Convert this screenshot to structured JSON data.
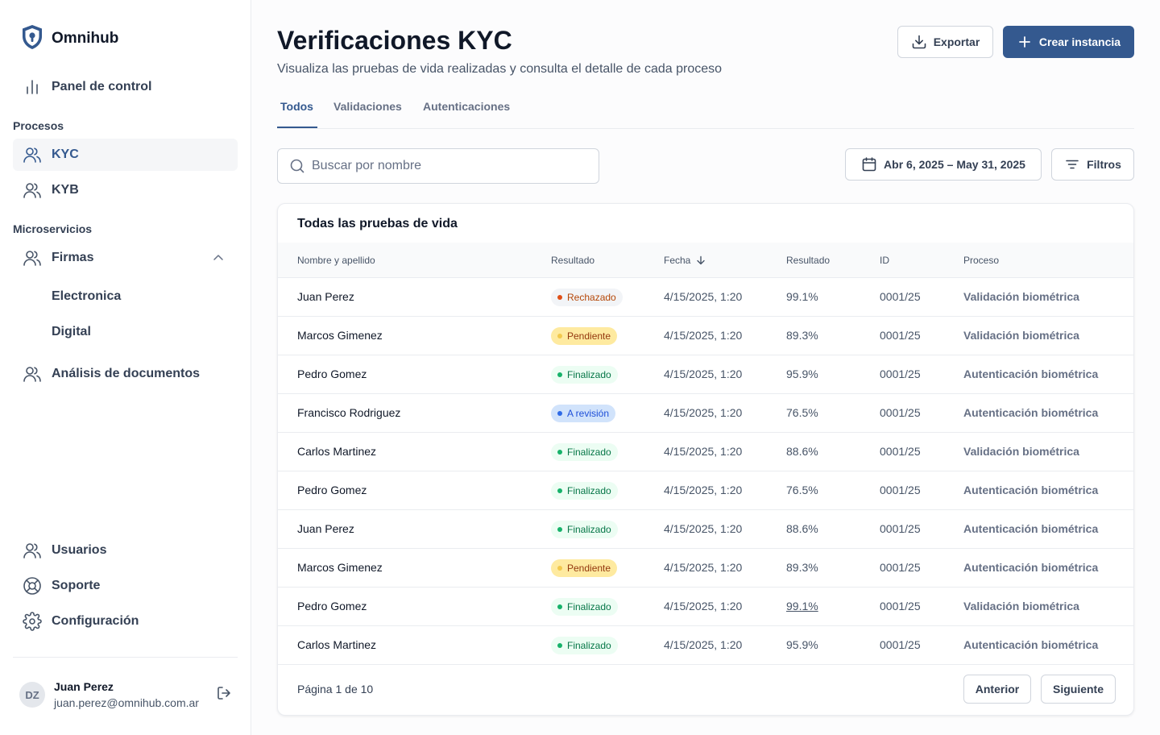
{
  "app": {
    "name": "Omnihub"
  },
  "sidebar": {
    "dashboard": "Panel de control",
    "section_procesos": "Procesos",
    "kyc": "KYC",
    "kyb": "KYB",
    "section_microservicios": "Microservicios",
    "firmas": "Firmas",
    "firmas_children": [
      "Electronica",
      "Digital"
    ],
    "analisis": "Análisis de documentos",
    "usuarios": "Usuarios",
    "soporte": "Soporte",
    "configuracion": "Configuración"
  },
  "user": {
    "initials": "DZ",
    "name": "Juan Perez",
    "email": "juan.perez@omnihub.com.ar"
  },
  "header": {
    "title": "Verificaciones KYC",
    "subtitle": "Visualiza las pruebas de vida realizadas y consulta el detalle de cada proceso",
    "export_label": "Exportar",
    "create_label": "Crear instancia"
  },
  "tabs": [
    "Todos",
    "Validaciones",
    "Autenticaciones"
  ],
  "search": {
    "placeholder": "Buscar por nombre"
  },
  "date_range": "Abr 6, 2025 – May 31, 2025",
  "filters_label": "Filtros",
  "table": {
    "title": "Todas las pruebas de vida",
    "columns": [
      "Nombre y apellido",
      "Resultado",
      "Fecha",
      "Resultado",
      "ID",
      "Proceso"
    ],
    "rows": [
      {
        "name": "Juan Perez",
        "status": "Rechazado",
        "status_kind": "rechazado",
        "date": "4/15/2025, 1:20",
        "score": "99.1%",
        "id": "0001/25",
        "process": "Validación biométrica"
      },
      {
        "name": "Marcos Gimenez",
        "status": "Pendiente",
        "status_kind": "pendiente",
        "date": "4/15/2025, 1:20",
        "score": "89.3%",
        "id": "0001/25",
        "process": "Validación biométrica"
      },
      {
        "name": "Pedro Gomez",
        "status": "Finalizado",
        "status_kind": "finalizado",
        "date": "4/15/2025, 1:20",
        "score": "95.9%",
        "id": "0001/25",
        "process": "Autenticación biométrica"
      },
      {
        "name": "Francisco Rodriguez",
        "status": "A revisión",
        "status_kind": "revision",
        "date": "4/15/2025, 1:20",
        "score": "76.5%",
        "id": "0001/25",
        "process": "Autenticación biométrica"
      },
      {
        "name": "Carlos Martinez",
        "status": "Finalizado",
        "status_kind": "finalizado",
        "date": "4/15/2025, 1:20",
        "score": "88.6%",
        "id": "0001/25",
        "process": "Validación biométrica"
      },
      {
        "name": "Pedro Gomez",
        "status": "Finalizado",
        "status_kind": "finalizado",
        "date": "4/15/2025, 1:20",
        "score": "76.5%",
        "id": "0001/25",
        "process": "Autenticación biométrica"
      },
      {
        "name": "Juan Perez",
        "status": "Finalizado",
        "status_kind": "finalizado",
        "date": "4/15/2025, 1:20",
        "score": "88.6%",
        "id": "0001/25",
        "process": "Autenticación biométrica"
      },
      {
        "name": "Marcos Gimenez",
        "status": "Pendiente",
        "status_kind": "pendiente",
        "date": "4/15/2025, 1:20",
        "score": "89.3%",
        "id": "0001/25",
        "process": "Autenticación biométrica"
      },
      {
        "name": "Pedro Gomez",
        "status": "Finalizado",
        "status_kind": "finalizado",
        "date": "4/15/2025, 1:20",
        "score": "99.1%",
        "score_linked": true,
        "id": "0001/25",
        "process": "Validación biométrica"
      },
      {
        "name": "Carlos Martinez",
        "status": "Finalizado",
        "status_kind": "finalizado",
        "date": "4/15/2025, 1:20",
        "score": "95.9%",
        "id": "0001/25",
        "process": "Autenticación biométrica"
      }
    ]
  },
  "pagination": {
    "info": "Página 1 de 10",
    "prev": "Anterior",
    "next": "Siguiente"
  },
  "colors": {
    "primary": "#34598f",
    "text": "#101828",
    "muted": "#475467",
    "border": "#eaecf0"
  }
}
